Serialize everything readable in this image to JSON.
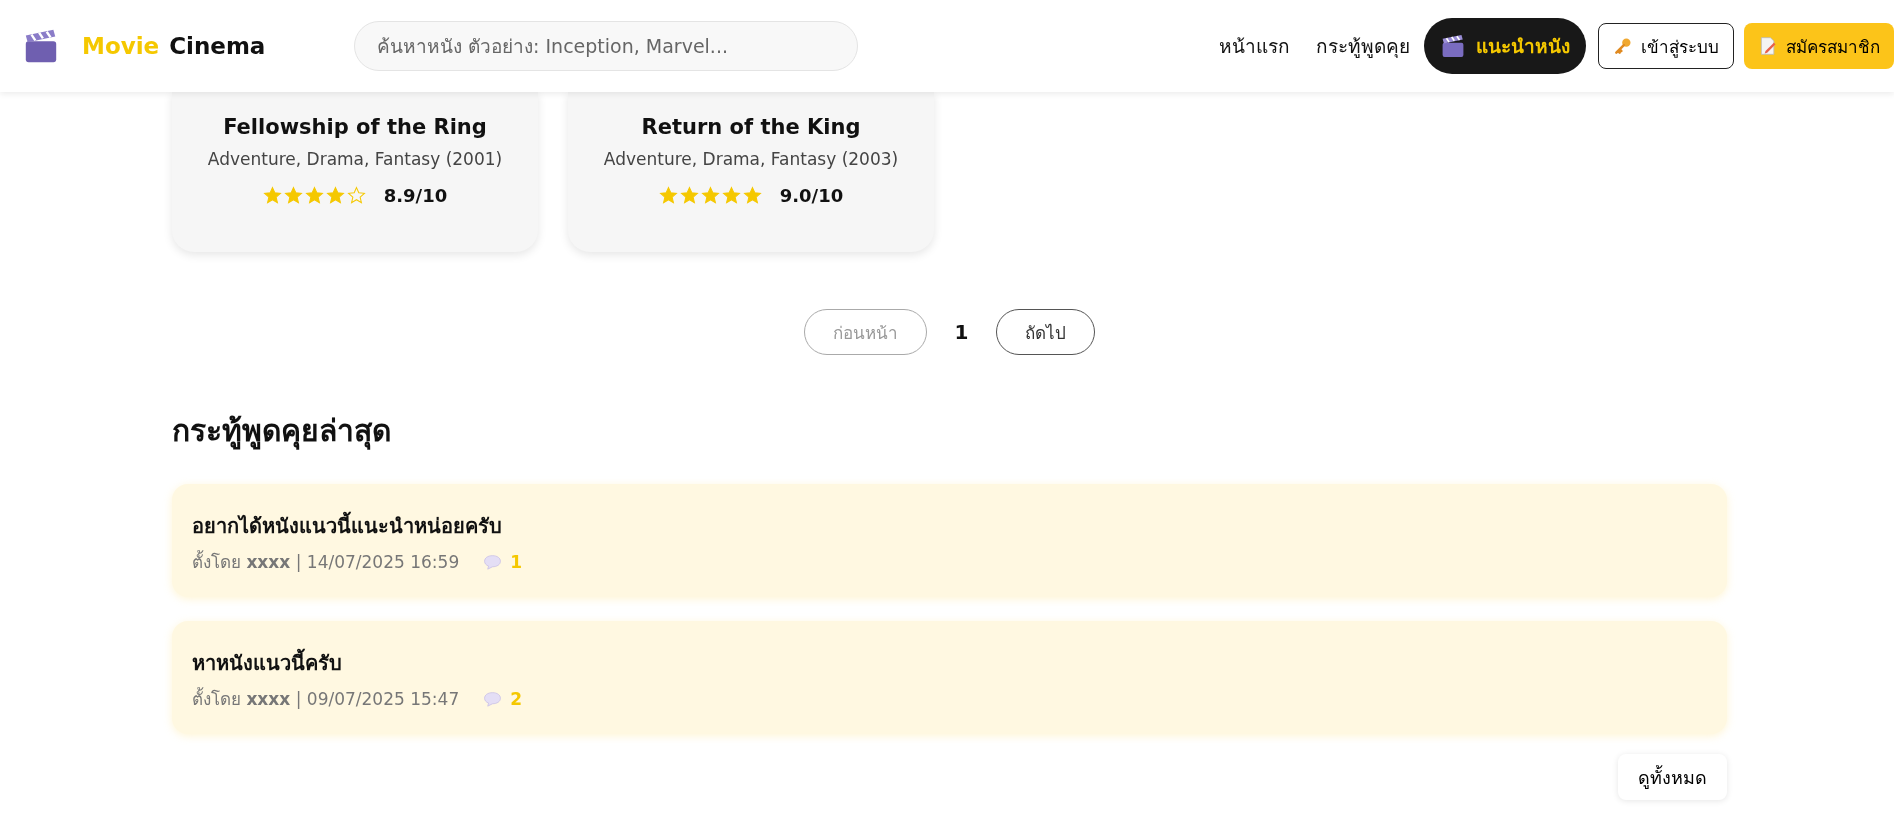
{
  "header": {
    "brand": [
      "Movie",
      "Cinema"
    ],
    "search": {
      "placeholder": "ค้นหาหนัง ตัวอย่าง: Inception, Marvel..."
    },
    "nav": [
      {
        "label": "หน้าแรก",
        "selected": false
      },
      {
        "label": "กระทู้พูดคุย",
        "selected": false
      },
      {
        "label": "แนะนำหนัง",
        "selected": true
      }
    ],
    "login": "เข้าสู่ระบบ",
    "register": "สมัครสมาชิก"
  },
  "movies": [
    {
      "title": "Fellowship of the Ring",
      "genre": "Adventure, Drama, Fantasy (2001)",
      "stars": 4,
      "rating": "8.9/10"
    },
    {
      "title": "Return of the King",
      "genre": "Adventure, Drama, Fantasy (2003)",
      "stars": 5,
      "rating": "9.0/10"
    }
  ],
  "pagination": {
    "previous": {
      "label": "ก่อนหน้า",
      "disabled": true
    },
    "page": "1",
    "next": {
      "label": "ถัดไป",
      "disabled": false
    }
  },
  "forum": {
    "heading": "กระทู้พูดคุยล่าสุด",
    "threads": [
      {
        "title": "อยากได้หนังแนวนี้แนะนำหน่อยครับ",
        "by": "ตั้งโดย",
        "author": "xxxx",
        "date": "| 14/07/2025 16:59",
        "comments": "1"
      },
      {
        "title": "หาหนังแนวนี้ครับ",
        "by": "ตั้งโดย",
        "author": "xxxx",
        "date": "| 09/07/2025 15:47",
        "comments": "2"
      }
    ],
    "view_all": "ดูทั้งหมด"
  }
}
